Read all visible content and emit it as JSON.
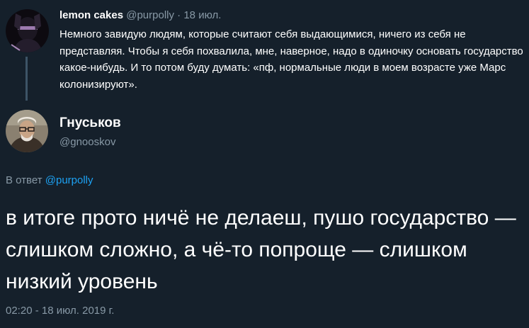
{
  "parent_tweet": {
    "name": "lemon cakes",
    "handle": "@purpolly",
    "separator": "·",
    "date": "18 июл.",
    "text": "Немного завидую людям, которые считают себя выдающимися, ничего из себя не представляя. Чтобы я себя похвалила, мне, наверное, надо в одиночку основать государство какое-нибудь. И то потом буду думать: «пф, нормальные люди в моем возрасте уже Марс колонизируют»."
  },
  "main_tweet": {
    "name": "Гнуськов",
    "handle": "@gnooskov",
    "reply_label": "В ответ",
    "reply_handle": "@purpolly",
    "text": "в итоге прото ничё не делаеш, пушо государство — слишком сложно, а чё-то попроще — слишком низкий уровень",
    "timestamp": "02:20 - 18 июл. 2019 г."
  },
  "colors": {
    "background": "#15202b",
    "text_primary": "#ffffff",
    "text_secondary": "#8899a6",
    "link": "#1da1f2",
    "thread_line": "#3d5466"
  }
}
